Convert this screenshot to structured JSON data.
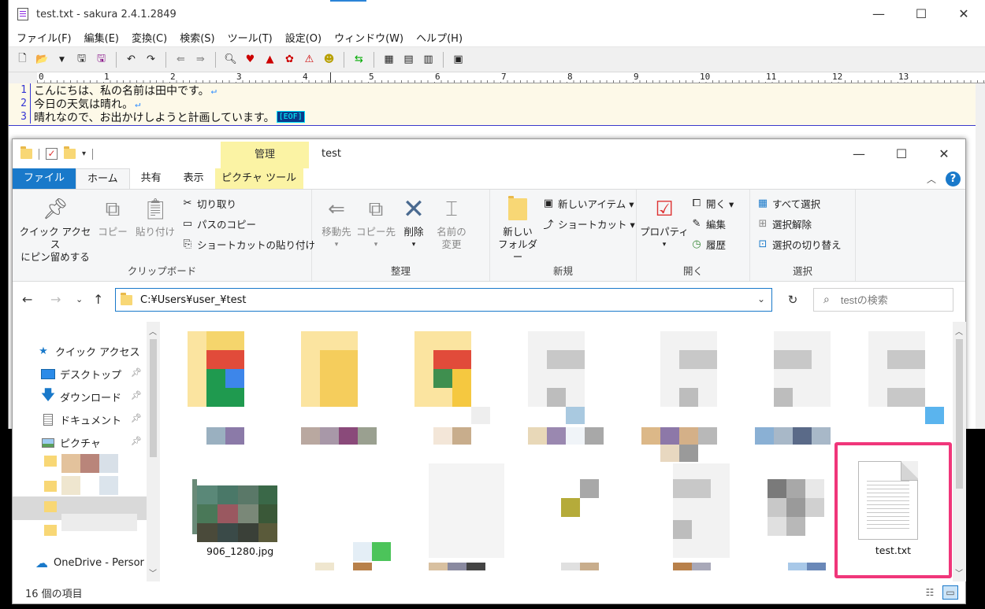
{
  "sakura": {
    "title": "test.txt - sakura 2.4.1.2849",
    "controls": {
      "minimize": "—",
      "maximize": "☐",
      "close": "✕"
    },
    "menu": [
      "ファイル(F)",
      "編集(E)",
      "変換(C)",
      "検索(S)",
      "ツール(T)",
      "設定(O)",
      "ウィンドウ(W)",
      "ヘルプ(H)"
    ],
    "ruler": [
      "0",
      "1",
      "2",
      "3",
      "4",
      "5",
      "6",
      "7",
      "8",
      "9",
      "10",
      "11",
      "12",
      "13"
    ],
    "lines": [
      {
        "num": "1",
        "text": "こんにちは、私の名前は田中です。"
      },
      {
        "num": "2",
        "text": "今日の天気は晴れ。"
      },
      {
        "num": "3",
        "text": "晴れなので、お出かけしようと計画しています。"
      }
    ],
    "return_mark": "↵",
    "eof": "[EOF]"
  },
  "explorer": {
    "manage_tab": "管理",
    "title": "test",
    "controls": {
      "minimize": "—",
      "maximize": "☐",
      "close": "✕"
    },
    "tabs": {
      "file": "ファイル",
      "home": "ホーム",
      "share": "共有",
      "view": "表示",
      "picture": "ピクチャ ツール"
    },
    "help": "?",
    "ribbon": {
      "clipboard": {
        "label": "クリップボード",
        "pin_line1": "クイック アクセス",
        "pin_line2": "にピン留めする",
        "copy": "コピー",
        "paste": "貼り付け",
        "cut": "切り取り",
        "copy_path": "パスのコピー",
        "paste_shortcut": "ショートカットの貼り付け"
      },
      "organize": {
        "label": "整理",
        "move_to": "移動先",
        "copy_to": "コピー先",
        "delete": "削除",
        "rename_line1": "名前の",
        "rename_line2": "変更"
      },
      "new": {
        "label": "新規",
        "new_folder_line1": "新しい",
        "new_folder_line2": "フォルダー",
        "new_item": "新しいアイテム ▾",
        "shortcut": "ショートカット ▾"
      },
      "open": {
        "label": "開く",
        "properties": "プロパティ",
        "open": "開く ▾",
        "edit": "編集",
        "history": "履歴"
      },
      "select": {
        "label": "選択",
        "select_all": "すべて選択",
        "select_none": "選択解除",
        "invert": "選択の切り替え"
      }
    },
    "address": "C:¥Users¥user_¥test",
    "search_placeholder": "testの検索",
    "nav": {
      "quick_access": "クイック アクセス",
      "desktop": "デスクトップ",
      "downloads": "ダウンロード",
      "documents": "ドキュメント",
      "pictures": "ピクチャ",
      "onedrive": "OneDrive - Persor"
    },
    "files": {
      "jpg_label": "906_1280.jpg",
      "txt_label": "test.txt"
    },
    "status": "16 個の項目"
  }
}
